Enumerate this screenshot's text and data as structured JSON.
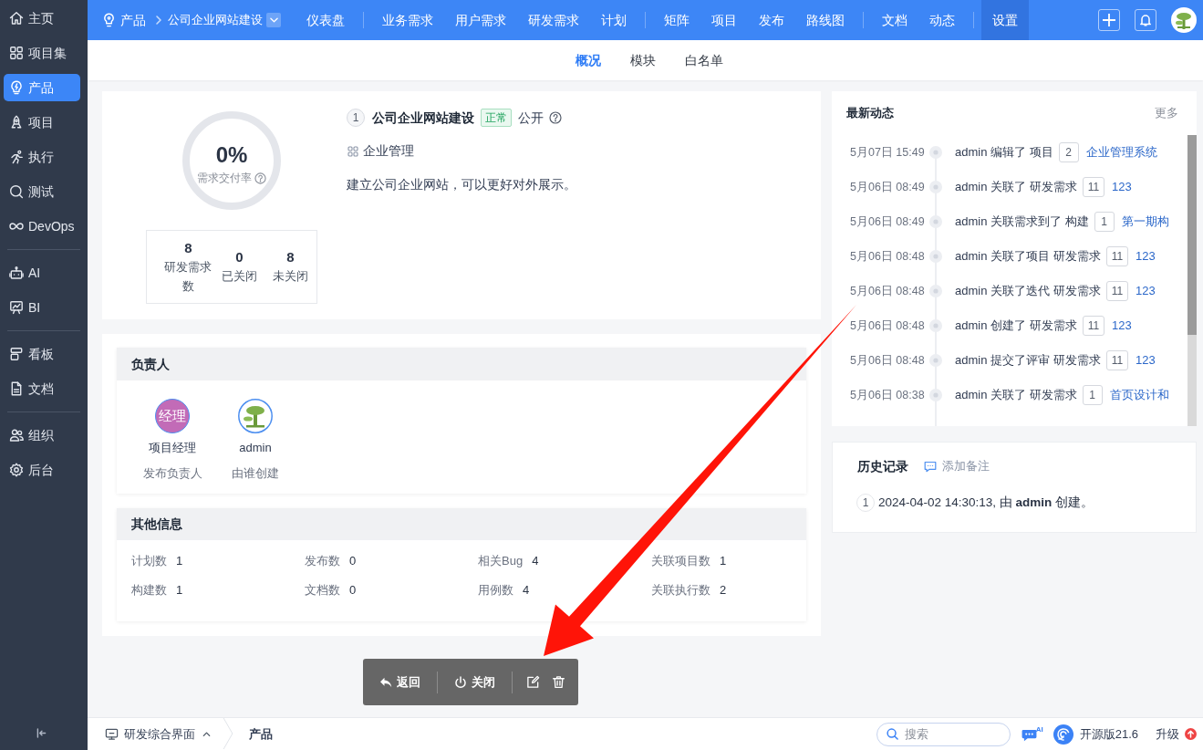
{
  "sidebar": {
    "groups": [
      [
        {
          "label": "主页",
          "selected": false
        },
        {
          "label": "项目集",
          "selected": false
        },
        {
          "label": "产品",
          "selected": true
        },
        {
          "label": "项目",
          "selected": false
        },
        {
          "label": "执行",
          "selected": false
        },
        {
          "label": "测试",
          "selected": false
        },
        {
          "label": "DevOps",
          "selected": false
        }
      ],
      [
        {
          "label": "AI",
          "selected": false
        },
        {
          "label": "BI",
          "selected": false
        }
      ],
      [
        {
          "label": "看板",
          "selected": false
        },
        {
          "label": "文档",
          "selected": false
        }
      ],
      [
        {
          "label": "组织",
          "selected": false
        },
        {
          "label": "后台",
          "selected": false
        }
      ]
    ]
  },
  "header": {
    "breadcrumb": [
      {
        "label": "产品"
      },
      {
        "label": "公司企业网站建设"
      }
    ],
    "nav_groups": [
      [
        {
          "label": "仪表盘",
          "selected": false
        }
      ],
      [
        {
          "label": "业务需求",
          "selected": false
        },
        {
          "label": "用户需求",
          "selected": false
        },
        {
          "label": "研发需求",
          "selected": false
        },
        {
          "label": "计划",
          "selected": false
        }
      ],
      [
        {
          "label": "矩阵",
          "selected": false
        },
        {
          "label": "项目",
          "selected": false
        },
        {
          "label": "发布",
          "selected": false
        },
        {
          "label": "路线图",
          "selected": false
        }
      ],
      [
        {
          "label": "文档",
          "selected": false
        },
        {
          "label": "动态",
          "selected": false
        }
      ],
      [
        {
          "label": "设置",
          "selected": true
        }
      ]
    ]
  },
  "tabs": [
    {
      "label": "概况",
      "selected": true
    },
    {
      "label": "模块",
      "selected": false
    },
    {
      "label": "白名单",
      "selected": false
    }
  ],
  "product": {
    "number": "1",
    "name": "公司企业网站建设",
    "status": "正常",
    "access": "公开",
    "line": "企业管理",
    "description": "建立公司企业网站，可以更好对外展示。",
    "delivery": {
      "value": "0%",
      "label": "需求交付率"
    },
    "stats": [
      {
        "value": "8",
        "label": "研发需求数"
      },
      {
        "value": "0",
        "label": "已关闭"
      },
      {
        "value": "8",
        "label": "未关闭"
      }
    ]
  },
  "owners": {
    "title": "负责人",
    "people": [
      {
        "kind": "text",
        "avatar_text": "经理",
        "name": "项目经理",
        "role": "发布负责人"
      },
      {
        "kind": "image",
        "name": "admin",
        "role": "由谁创建"
      }
    ]
  },
  "other_info": {
    "title": "其他信息",
    "fields": [
      {
        "label": "计划数",
        "value": "1"
      },
      {
        "label": "发布数",
        "value": "0"
      },
      {
        "label": "相关Bug",
        "value": "4"
      },
      {
        "label": "关联项目数",
        "value": "1"
      },
      {
        "label": "构建数",
        "value": "1"
      },
      {
        "label": "文档数",
        "value": "0"
      },
      {
        "label": "用例数",
        "value": "4"
      },
      {
        "label": "关联执行数",
        "value": "2"
      }
    ]
  },
  "activity": {
    "title": "最新动态",
    "more": "更多",
    "entries": [
      {
        "time": "5月07日 15:49",
        "text": "admin 编辑了 项目",
        "id": "2",
        "link": "企业管理系统"
      },
      {
        "time": "5月06日 08:49",
        "text": "admin 关联了 研发需求",
        "id": "11",
        "link": "123"
      },
      {
        "time": "5月06日 08:49",
        "text": "admin 关联需求到了 构建",
        "id": "1",
        "link": "第一期构"
      },
      {
        "time": "5月06日 08:48",
        "text": "admin 关联了项目 研发需求",
        "id": "11",
        "link": "123"
      },
      {
        "time": "5月06日 08:48",
        "text": "admin 关联了迭代 研发需求",
        "id": "11",
        "link": "123"
      },
      {
        "time": "5月06日 08:48",
        "text": "admin 创建了 研发需求",
        "id": "11",
        "link": "123"
      },
      {
        "time": "5月06日 08:48",
        "text": "admin 提交了评审 研发需求",
        "id": "11",
        "link": "123"
      },
      {
        "time": "5月06日 08:38",
        "text": "admin 关联了 研发需求",
        "id": "1",
        "link": "首页设计和"
      }
    ]
  },
  "history": {
    "title": "历史记录",
    "add_note": "添加备注",
    "entries": [
      {
        "number": "1",
        "text": "2024-04-02 14:30:13, 由 **admin** 创建。"
      }
    ]
  },
  "toolbar": {
    "buttons": [
      {
        "kind": "back",
        "label": "返回"
      },
      {
        "kind": "close",
        "label": "关闭"
      },
      {
        "kind": "edit"
      },
      {
        "kind": "delete"
      }
    ]
  },
  "status_bar": {
    "workspace": "研发综合界面",
    "current": "产品",
    "search": {
      "placeholder": "搜索"
    },
    "ai_badge": "AI",
    "edition": "开源版21.6",
    "upgrade": "升级"
  }
}
